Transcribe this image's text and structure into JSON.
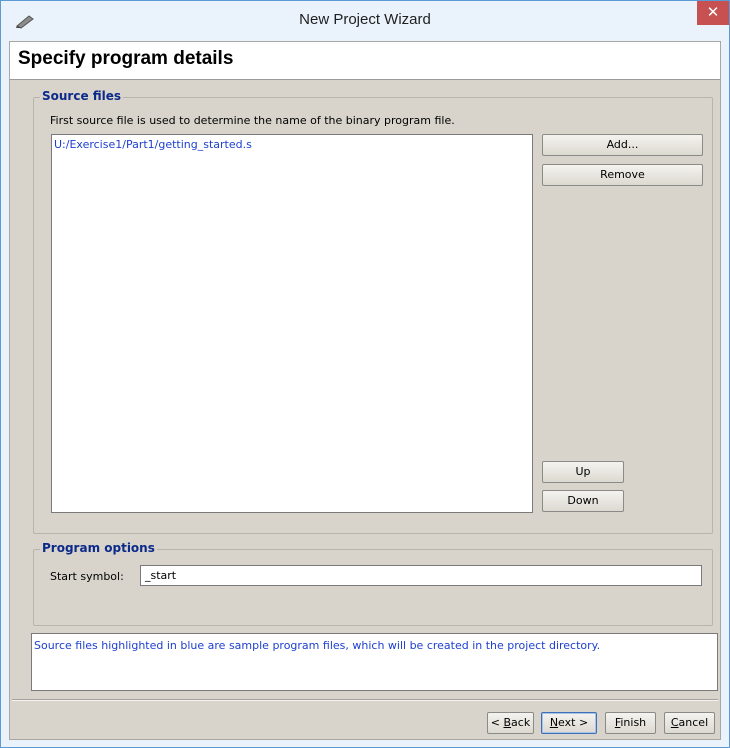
{
  "window": {
    "title": "New Project Wizard",
    "close_glyph": "✕",
    "icon": "pencil-icon"
  },
  "header": {
    "title": "Specify program details"
  },
  "source_files": {
    "legend": "Source files",
    "hint": "First source file is used to determine the name of the binary program file.",
    "files": [
      "U:/Exercise1/Part1/getting_started.s"
    ],
    "buttons": {
      "add": "Add...",
      "remove": "Remove",
      "up": "Up",
      "down": "Down"
    }
  },
  "program_options": {
    "legend": "Program options",
    "start_symbol_label": "Start symbol:",
    "start_symbol_value": "_start"
  },
  "info": {
    "text": "Source files highlighted in blue are sample program files, which will be created in the project directory."
  },
  "footer": {
    "back": {
      "prefix": "< ",
      "mnemonic": "B",
      "rest": "ack"
    },
    "next": {
      "mnemonic": "N",
      "rest": "ext >"
    },
    "finish": {
      "mnemonic": "F",
      "rest": "inish"
    },
    "cancel": {
      "mnemonic": "C",
      "rest": "ancel"
    }
  },
  "colors": {
    "accent_blue": "#1d3fd0",
    "legend_blue": "#0b2a8a",
    "close_red": "#c75050",
    "panel_bg": "#d8d4cb"
  }
}
